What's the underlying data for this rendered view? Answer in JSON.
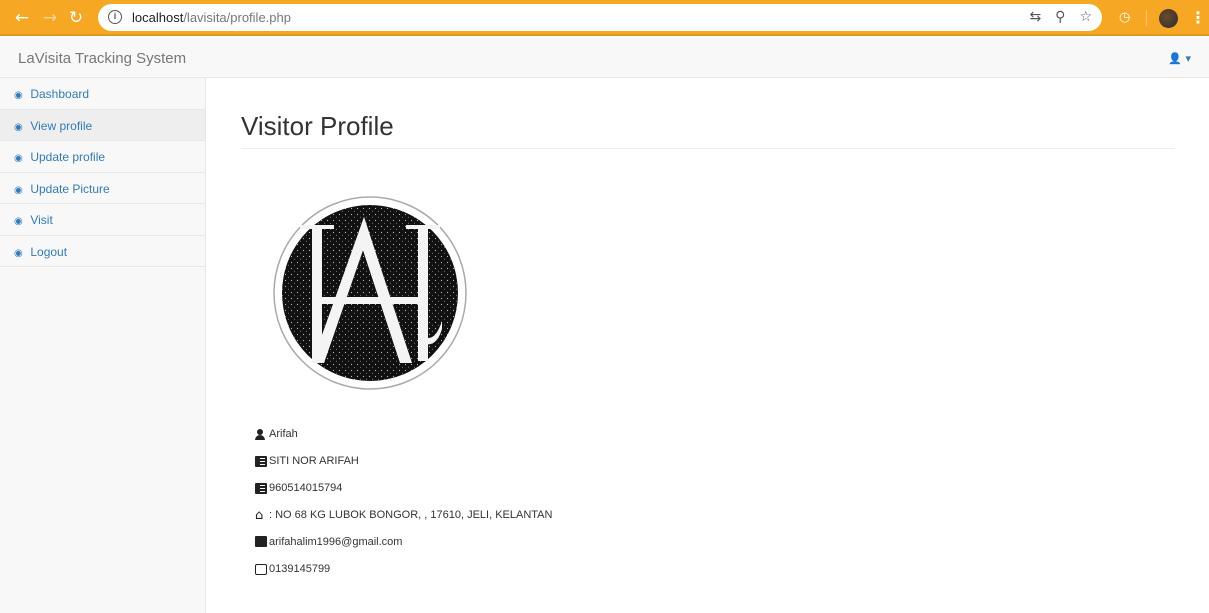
{
  "browser": {
    "url_host": "localhost",
    "url_path": "/lavisita/profile.php"
  },
  "navbar": {
    "brand": "LaVisita Tracking System"
  },
  "sidebar": {
    "items": [
      {
        "label": "Dashboard",
        "active": false
      },
      {
        "label": "View profile",
        "active": true
      },
      {
        "label": "Update profile",
        "active": false
      },
      {
        "label": "Update Picture",
        "active": false
      },
      {
        "label": "Visit",
        "active": false
      },
      {
        "label": "Logout",
        "active": false
      }
    ]
  },
  "main": {
    "title": "Visitor Profile",
    "profile": {
      "username": "Arifah",
      "full_name": "SITI NOR ARIFAH",
      "ic_number": "960514015794",
      "address": ": NO 68 KG LUBOK BONGOR, , 17610, JELI, KELANTAN",
      "email": "arifahalim1996@gmail.com",
      "phone": "0139145799"
    }
  },
  "colors": {
    "browser_accent": "#f6a723",
    "link": "#337ab7"
  }
}
